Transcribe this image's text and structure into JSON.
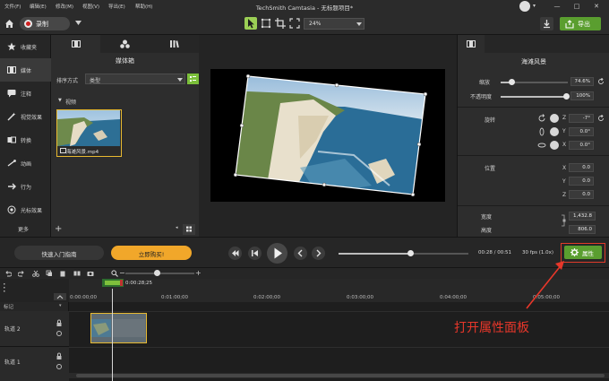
{
  "menu": [
    "文件(F)",
    "编辑(E)",
    "修改(M)",
    "视图(V)",
    "导出(E)",
    "帮助(H)"
  ],
  "app_title": "TechSmith Camtasia - 无标题项目*",
  "window_controls": [
    "—",
    "□",
    "✕"
  ],
  "toolbar": {
    "record_label": "录制",
    "zoom_value": "24%",
    "export_label": "导出"
  },
  "left_tabs": [
    "收藏夹",
    "媒体",
    "注释",
    "视觉效果",
    "转换",
    "动画",
    "行为",
    "光标效果"
  ],
  "more_label": "更多",
  "media": {
    "title": "媒体箱",
    "sort_label": "排序方式",
    "sort_value": "类型",
    "section": "视频",
    "thumbnail_name": "海滩风景.mp4"
  },
  "properties": {
    "title": "海滩风景",
    "scale_label": "缩放",
    "scale_value": "74.6%",
    "opacity_label": "不透明度",
    "opacity_value": "100%",
    "rotation_label": "旋转",
    "rot_z": "-7°",
    "rot_y": "0.0°",
    "rot_x": "0.0°",
    "position_label": "位置",
    "pos_x": "0.0",
    "pos_y": "0.0",
    "pos_z": "0.0",
    "width_label": "宽度",
    "width_value": "1,432.8",
    "height_label": "高度",
    "height_value": "806.0",
    "axis_x": "X",
    "axis_y": "Y",
    "axis_z": "Z"
  },
  "playback": {
    "guide_label": "快速入门指南",
    "buy_label": "立即购买!",
    "time": "00:28 / 00:51",
    "fps": "30 fps (1.0x)",
    "properties_button": "属性",
    "progress": 0.55
  },
  "timeline": {
    "playhead_time": "0:00:28;25",
    "ruler": [
      "0:00:00;00",
      "0:01:00;00",
      "0:02:00;00",
      "0:03:00;00",
      "0:04:00;00",
      "0:05:00;00"
    ],
    "marker_label": "标记",
    "tracks": [
      "轨道 2",
      "轨道 1"
    ]
  },
  "annotation": "打开属性面板",
  "colors": {
    "accent_green": "#5a9e2f",
    "buy_orange": "#f1a72a",
    "highlight_red": "#e03a2a",
    "selection_yellow": "#e8b930"
  }
}
